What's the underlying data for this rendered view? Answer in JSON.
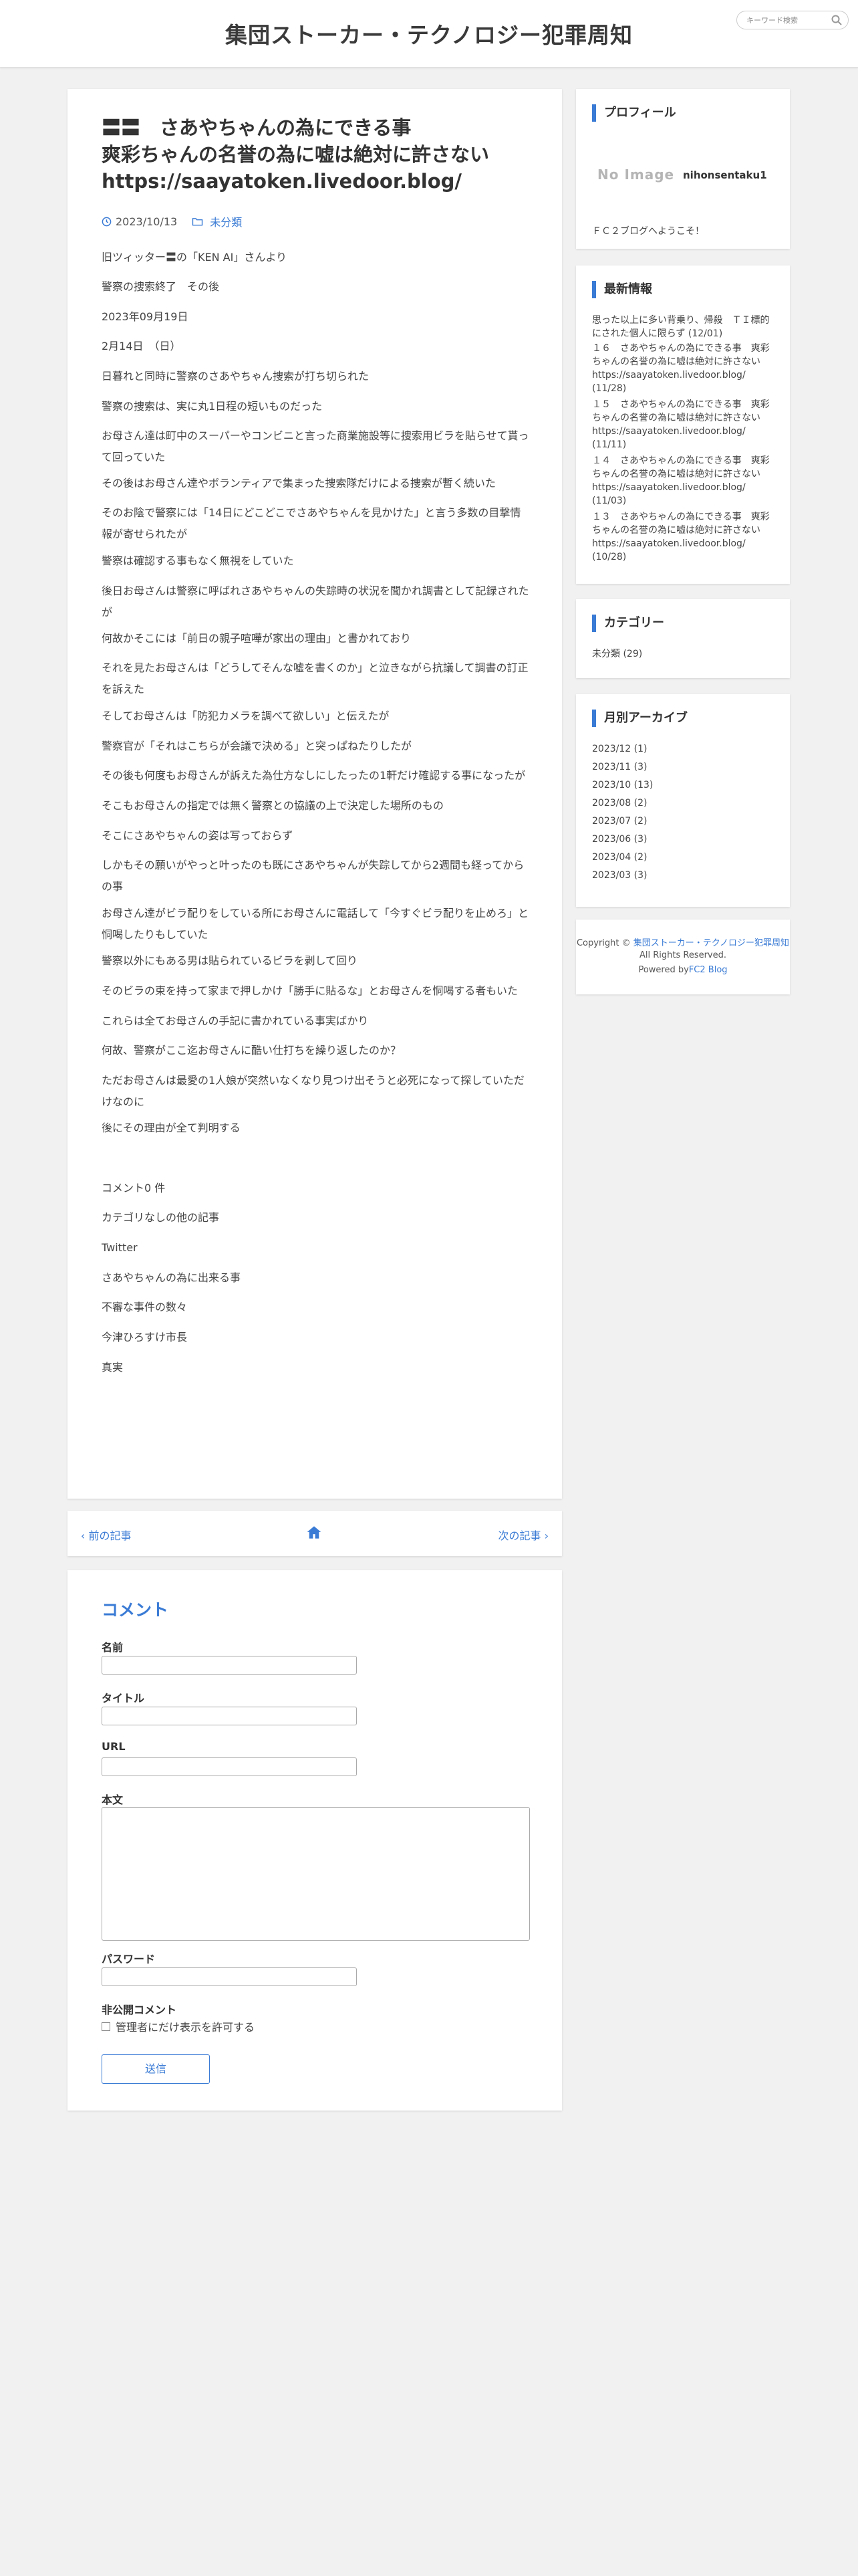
{
  "header": {
    "site_title": "集団ストーカー・テクノロジー犯罪周知",
    "search_placeholder": "キーワード検索"
  },
  "post": {
    "title_lines": [
      "〓〓　さあやちゃんの為にできる事",
      "爽彩ちゃんの名誉の為に嘘は絶対に許さない",
      "https://saayatoken.livedoor.blog/"
    ],
    "date": "2023/10/13",
    "category": "未分類",
    "paragraphs": [
      "旧ツィッター〓の「KEN AI」さんより",
      "警察の捜索終了　その後",
      "2023年09月19日",
      "2月14日　（日）",
      "日暮れと同時に警察のさあやちゃん捜索が打ち切られた",
      "警察の捜索は、実に丸1日程の短いものだった",
      "お母さん達は町中のスーパーやコンビニと言った商業施設等に捜索用ビラを貼らせて貰って回っていた",
      "その後はお母さん達やボランティアで集まった捜索隊だけによる捜索が暫く続いた",
      "そのお陰で警察には「14日にどこどこでさあやちゃんを見かけた」と言う多数の目撃情報が寄せられたが",
      "警察は確認する事もなく無視をしていた",
      "後日お母さんは警察に呼ばれさあやちゃんの失踪時の状況を聞かれ調書として記録されたが",
      "何故かそこには「前日の親子喧嘩が家出の理由」と書かれており",
      "それを見たお母さんは「どうしてそんな嘘を書くのか」と泣きながら抗議して調書の訂正を訴えた",
      "そしてお母さんは「防犯カメラを調べて欲しい」と伝えたが",
      "警察官が「それはこちらが会議で決める」と突っぱねたりしたが",
      "その後も何度もお母さんが訴えた為仕方なしにしたったの1軒だけ確認する事になったが",
      "そこもお母さんの指定では無く警察との協議の上で決定した場所のもの",
      "そこにさあやちゃんの姿は写っておらず",
      "しかもその願いがやっと叶ったのも既にさあやちゃんが失踪してから2週間も経ってからの事",
      "お母さん達がビラ配りをしている所にお母さんに電話して「今すぐビラ配りを止めろ」と恫喝したりもしていた",
      "警察以外にもある男は貼られているビラを剥して回り",
      "そのビラの束を持って家まで押しかけ「勝手に貼るな」とお母さんを恫喝する者もいた",
      "これらは全てお母さんの手記に書かれている事実ばかり",
      "何故、警察がここ迄お母さんに酷い仕打ちを繰り返したのか？",
      "ただお母さんは最愛の1人娘が突然いなくなり見つけ出そうと必死になって探していただけなのに",
      "後にその理由が全て判明する",
      "コメント0 件",
      "カテゴリなしの他の記事",
      "Twitter",
      "さあやちゃんの為に出来る事",
      "不審な事件の数々",
      "今津ひろすけ市長",
      "真実"
    ]
  },
  "post_nav": {
    "prev_label": "前の記事",
    "next_label": "次の記事"
  },
  "comment_form": {
    "title": "コメント",
    "name_label": "名前",
    "subject_label": "タイトル",
    "url_label": "URL",
    "body_label": "本文",
    "password_label": "パスワード",
    "secret_label": "非公開コメント",
    "secret_checkbox_label": "管理者にだけ表示を許可する",
    "submit_label": "送信"
  },
  "sidebar": {
    "profile": {
      "title": "プロフィール",
      "no_image_text": "No Image",
      "name": "nihonsentaku1",
      "description": "ＦＣ２ブログへようこそ！"
    },
    "latest": {
      "title": "最新情報",
      "items": [
        "思った以上に多い背乗り、帰殺　ＴＩ標的にされた個人に限らず (12/01)",
        "１６　さあやちゃんの為にできる事　爽彩ちゃんの名誉の為に嘘は絶対に許さないhttps://saayatoken.livedoor.blog/ (11/28)",
        "１５　さあやちゃんの為にできる事　爽彩ちゃんの名誉の為に嘘は絶対に許さないhttps://saayatoken.livedoor.blog/ (11/11)",
        "１４　さあやちゃんの為にできる事　爽彩ちゃんの名誉の為に嘘は絶対に許さないhttps://saayatoken.livedoor.blog/ (11/03)",
        "１３　さあやちゃんの為にできる事　爽彩ちゃんの名誉の為に嘘は絶対に許さないhttps://saayatoken.livedoor.blog/ (10/28)"
      ]
    },
    "categories": {
      "title": "カテゴリー",
      "items": [
        "未分類 (29)"
      ]
    },
    "archives": {
      "title": "月別アーカイブ",
      "items": [
        "2023/12 (1)",
        "2023/11 (3)",
        "2023/10 (13)",
        "2023/08 (2)",
        "2023/07 (2)",
        "2023/06 (3)",
        "2023/04 (2)",
        "2023/03 (3)"
      ]
    },
    "footer": {
      "copyright_prefix": "Copyright ©",
      "copyright_link": "集団ストーカー・テクノロジー犯罪周知",
      "rights": "All Rights Reserved.",
      "powered_prefix": "Powered by",
      "powered_link": "FC2 Blog"
    }
  },
  "colors": {
    "accent": "#3a7bd5",
    "background": "#f1f1f1",
    "card": "#ffffff"
  },
  "icons": [
    "search-icon",
    "clock-icon",
    "folder-icon",
    "chevron-left-icon",
    "home-icon",
    "chevron-right-icon"
  ]
}
